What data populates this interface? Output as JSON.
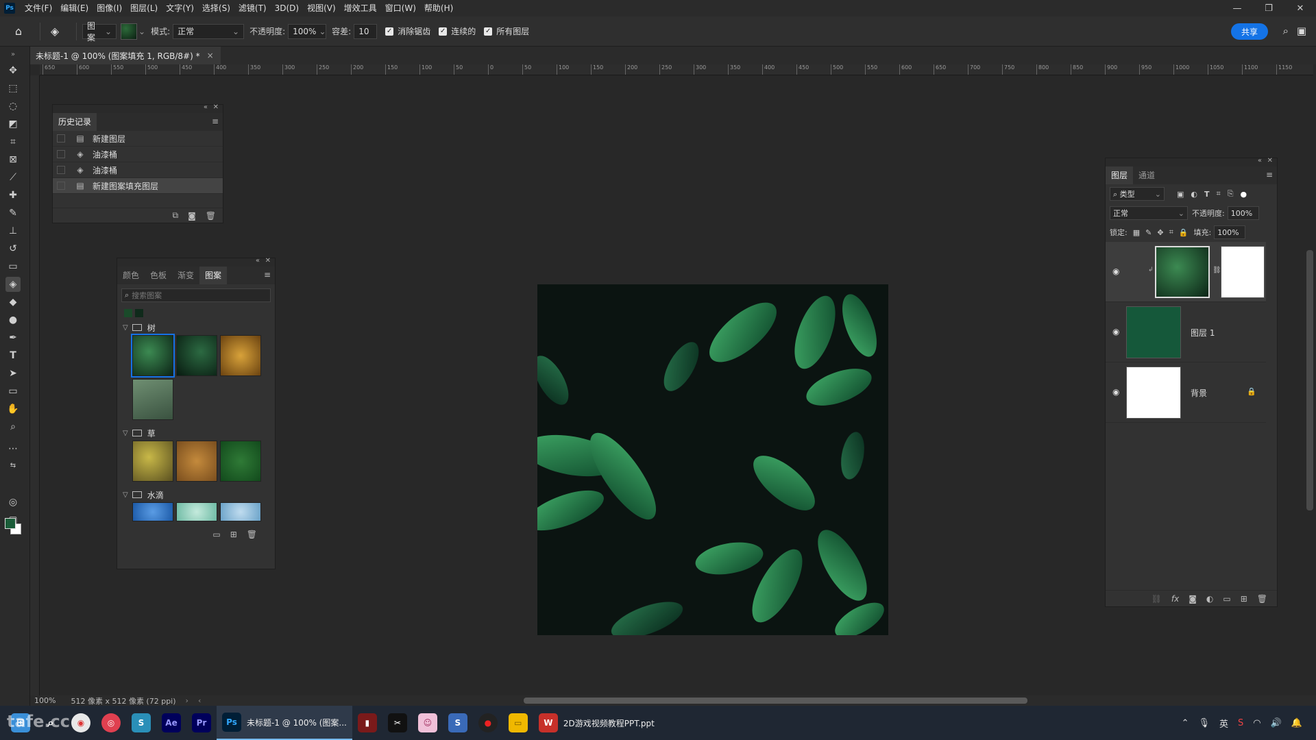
{
  "menubar": {
    "logo": "Ps",
    "items": [
      "文件(F)",
      "编辑(E)",
      "图像(I)",
      "图层(L)",
      "文字(Y)",
      "选择(S)",
      "滤镜(T)",
      "3D(D)",
      "视图(V)",
      "增效工具",
      "窗口(W)",
      "帮助(H)"
    ],
    "window_controls": [
      "—",
      "❐",
      "✕"
    ]
  },
  "options": {
    "source_select": "图案",
    "mode_label": "模式:",
    "mode_value": "正常",
    "opacity_label": "不透明度:",
    "opacity_value": "100%",
    "tolerance_label": "容差:",
    "tolerance_value": "10",
    "antialias_label": "消除锯齿",
    "contiguous_label": "连续的",
    "all_layers_label": "所有图层",
    "share_label": "共享"
  },
  "document": {
    "tab_title": "未标题-1 @ 100% (图案填充 1, RGB/8#) *",
    "close": "×"
  },
  "ruler": {
    "ticks": [
      "650",
      "600",
      "550",
      "500",
      "450",
      "400",
      "350",
      "300",
      "250",
      "200",
      "150",
      "100",
      "50",
      "0",
      "50",
      "100",
      "150",
      "200",
      "250",
      "300",
      "350",
      "400",
      "450",
      "500",
      "550",
      "600",
      "650",
      "700",
      "750",
      "800",
      "850",
      "900",
      "950",
      "1000",
      "1050",
      "1100",
      "1150"
    ]
  },
  "history": {
    "tab": "历史记录",
    "items": [
      {
        "label": "新建图层",
        "icon": "document-icon"
      },
      {
        "label": "油漆桶",
        "icon": "paint-bucket-icon"
      },
      {
        "label": "油漆桶",
        "icon": "paint-bucket-icon"
      },
      {
        "label": "新建图案填充图层",
        "icon": "document-icon"
      }
    ]
  },
  "patterns": {
    "tabs": [
      "颜色",
      "色板",
      "渐变",
      "图案"
    ],
    "active_tab": "图案",
    "search_placeholder": "搜索图案",
    "groups": [
      {
        "name": "树",
        "thumbs": [
          "#163a24",
          "#0f2a1b",
          "#b8821f",
          "#5c7a5e"
        ]
      },
      {
        "name": "草",
        "thumbs": [
          "#9c8b2c",
          "#a4702c",
          "#1e5a28"
        ]
      },
      {
        "name": "水滴",
        "thumbs": [
          "#2e74c4",
          "#8fd2c0",
          "#8cc0de"
        ]
      }
    ]
  },
  "layers": {
    "tabs": [
      "图层",
      "通道"
    ],
    "filter_label": "类型",
    "blend_mode": "正常",
    "opacity_label": "不透明度:",
    "opacity_value": "100%",
    "lock_label": "锁定:",
    "fill_label": "填充:",
    "fill_value": "100%",
    "items": [
      {
        "name": "",
        "thumb": "pattern",
        "mask": true
      },
      {
        "name": "图层 1",
        "thumb_color": "#15583a"
      },
      {
        "name": "背景",
        "thumb_color": "#ffffff",
        "locked": true
      }
    ]
  },
  "status": {
    "zoom": "100%",
    "info": "512 像素 x 512 像素 (72 ppi)"
  },
  "taskbar": {
    "apps": [
      {
        "label": "",
        "icon": "Ae",
        "color": "#00005b",
        "fg": "#9999ff"
      },
      {
        "label": "",
        "icon": "Pr",
        "color": "#00005b",
        "fg": "#9999ff"
      },
      {
        "label": "未标题-1 @ 100% (图案...",
        "icon": "Ps",
        "color": "#001e36",
        "fg": "#31a8ff"
      },
      {
        "label": "2D游戏视频教程PPT.ppt",
        "icon": "W",
        "color": "#c7302a",
        "fg": "#ffffff"
      }
    ],
    "ime": "英",
    "watermark": "tafe.cc"
  }
}
